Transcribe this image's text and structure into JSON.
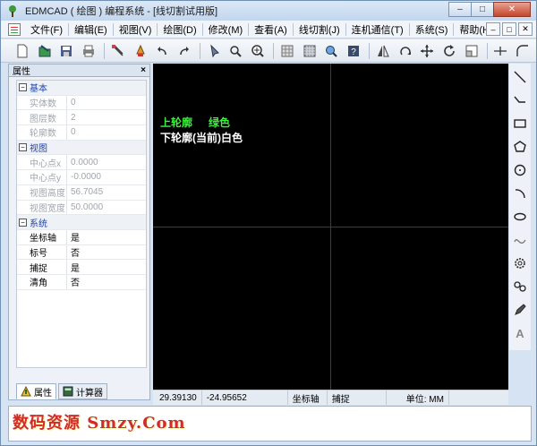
{
  "window": {
    "title": "EDMCAD ( 绘图 ) 编程系统 - [线切割试用版]",
    "controls": {
      "minimize": "–",
      "maximize": "□",
      "close": "✕"
    }
  },
  "menu": {
    "items": [
      "文件(F)",
      "编辑(E)",
      "视图(V)",
      "绘图(D)",
      "修改(M)",
      "查看(A)",
      "线切割(J)",
      "连机通信(T)",
      "系统(S)",
      "帮助(H)"
    ],
    "mdi_controls": [
      "–",
      "□",
      "✕"
    ]
  },
  "toolbar": {
    "icons": [
      "new-file-icon",
      "open-file-icon",
      "save-icon",
      "print-icon",
      "cut-icon",
      "paint-icon",
      "undo-icon",
      "redo-icon",
      "pick-icon",
      "zoom-window-icon",
      "zoom-in-icon",
      "layer-icon",
      "grid-icon",
      "magnify-icon",
      "help-icon",
      "mirror-icon",
      "rotate-icon",
      "move-icon",
      "refresh-icon",
      "scale-icon",
      "trim-icon",
      "corner-icon"
    ]
  },
  "properties_panel": {
    "title": "属性",
    "close": "×",
    "categories": [
      {
        "label": "基本",
        "toggle": "⊟",
        "rows": [
          {
            "name": "实体数",
            "value": "0",
            "dim": true
          },
          {
            "name": "图层数",
            "value": "2",
            "dim": true
          },
          {
            "name": "轮廓数",
            "value": "0",
            "dim": true
          }
        ]
      },
      {
        "label": "视图",
        "toggle": "⊟",
        "rows": [
          {
            "name": "中心点x",
            "value": "0.0000",
            "dim": true
          },
          {
            "name": "中心点y",
            "value": "-0.0000",
            "dim": true
          },
          {
            "name": "视图高度",
            "value": "56.7045",
            "dim": true
          },
          {
            "name": "视图宽度",
            "value": "50.0000",
            "dim": true
          }
        ]
      },
      {
        "label": "系统",
        "toggle": "⊟",
        "rows": [
          {
            "name": "坐标轴",
            "value": "是",
            "dim": false
          },
          {
            "name": "标号",
            "value": "否",
            "dim": false
          },
          {
            "name": "捕捉",
            "value": "是",
            "dim": false
          },
          {
            "name": "清角",
            "value": "否",
            "dim": false
          }
        ]
      }
    ],
    "tabs": [
      {
        "label": "属性",
        "icon": "properties-icon"
      },
      {
        "label": "计算器",
        "icon": "calculator-icon"
      }
    ]
  },
  "canvas": {
    "upper_profile_label": "上轮廓",
    "upper_profile_color_name": "绿色",
    "lower_profile_text": "下轮廓(当前)白色",
    "axis_color": "#1f2fd0",
    "upper_color": "#3cf03c"
  },
  "drawbar": {
    "icons": [
      "line-icon",
      "polyline-icon",
      "rectangle-icon",
      "polygon-icon",
      "circle-icon",
      "arc-icon",
      "ellipse-icon",
      "spline-icon",
      "gear-icon",
      "chain-icon",
      "pen-icon",
      "text-icon"
    ]
  },
  "status": {
    "x": "29.39130",
    "y": "-24.95652",
    "axis": "坐标轴",
    "snap": "捕捉",
    "unit": "单位: MM"
  },
  "watermark": "数码资源 Smzy.Com"
}
